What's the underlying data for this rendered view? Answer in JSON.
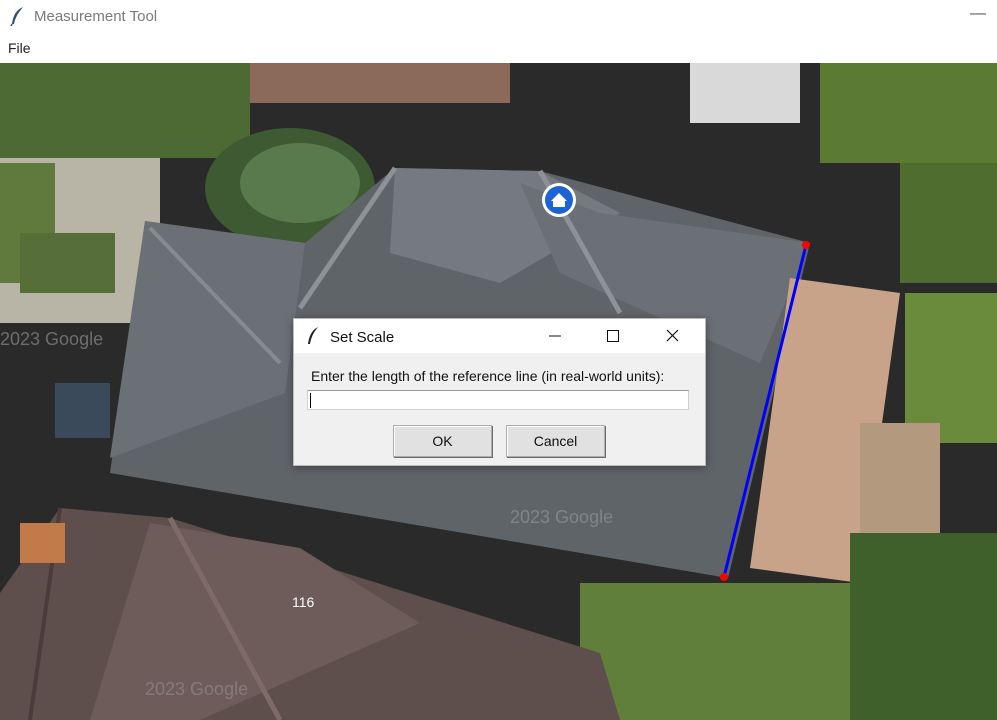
{
  "window": {
    "title": "Measurement Tool",
    "minimize_glyph": "—"
  },
  "menu": {
    "items": [
      {
        "label": "File"
      }
    ]
  },
  "map": {
    "house_number": "116",
    "watermark": "2023 Google",
    "reference_line_color": "#0000ff",
    "endpoint_color": "#ff0000",
    "marker_icon": "home-marker-icon"
  },
  "dialog": {
    "title": "Set Scale",
    "prompt": "Enter the length of the reference line (in real-world units):",
    "input_value": "",
    "ok_label": "OK",
    "cancel_label": "Cancel",
    "minimize_glyph": "—",
    "close_glyph": "✕"
  }
}
